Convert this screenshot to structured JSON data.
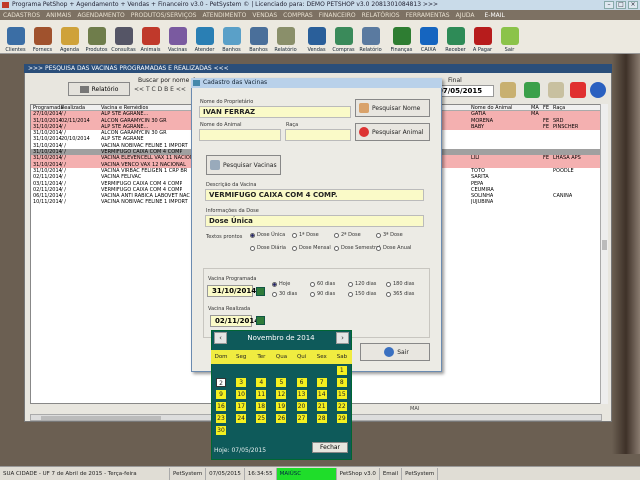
{
  "window": {
    "title": "Programa PetShop + Agendamento + Vendas + Financeiro v3.0 - PetSystem © | Licenciado para: DEMO PETSHOP v3.0 2081301084813 >>>"
  },
  "menu": [
    "CADASTROS",
    "ANIMAIS",
    "AGENDAMENTO",
    "PRODUTOS/SERVIÇOS",
    "ATENDIMENTO",
    "VENDAS",
    "COMPRAS",
    "FINANCEIRO",
    "RELATÓRIOS",
    "FERRAMENTAS",
    "AJUDA"
  ],
  "menu_email": "E-MAIL",
  "toolbar": [
    {
      "label": "Clientes",
      "color": "#3b6ea5"
    },
    {
      "label": "Fornecs",
      "color": "#a0522d"
    },
    {
      "label": "Agenda",
      "color": "#cfa23a"
    },
    {
      "label": "Produtos",
      "color": "#6f7d4b"
    },
    {
      "label": "Consultas",
      "color": "#556"
    },
    {
      "label": "Animais",
      "color": "#c0392b"
    },
    {
      "label": "Vacinas",
      "color": "#7a5aa0"
    },
    {
      "label": "Atender",
      "color": "#2a7fb4"
    },
    {
      "label": "Banhos",
      "color": "#5aa0c8"
    },
    {
      "label": "Banhos",
      "color": "#4a6f9a"
    },
    {
      "label": "Relatório",
      "color": "#8a8f6a"
    },
    {
      "label": "Vendas",
      "color": "#2a5f9a"
    },
    {
      "label": "Compras",
      "color": "#3a8a5a"
    },
    {
      "label": "Relatório",
      "color": "#5a7aa0"
    },
    {
      "label": "Finanças",
      "color": "#2e7d32"
    },
    {
      "label": "CAIXA",
      "color": "#1565c0"
    },
    {
      "label": "Receber",
      "color": "#2e8b57"
    },
    {
      "label": "A Pagar",
      "color": "#b71c1c"
    },
    {
      "label": "Sair",
      "color": "#8bc34a"
    }
  ],
  "panel": {
    "header": ">>>  PESQUISA DAS VACINAS PROGRAMADAS E REALIZADAS  <<<",
    "relatorio_label": "Relatório",
    "busca_label": "Buscar por nome de",
    "alphabet": "<< T C D B E <<",
    "final_label": "Final",
    "final_date": "07/05/2015"
  },
  "table": {
    "columns": [
      "Programada",
      "Realizada",
      "Vacina e Remédios",
      "Nome do Animal",
      "MA",
      "FE",
      "Raça"
    ],
    "rows": [
      {
        "cells": [
          "27/10/2014",
          "/  /",
          "ALP STE AGRANE...",
          "GATIA",
          "MA",
          "",
          ""
        ],
        "bg": "#f4b0b0"
      },
      {
        "cells": [
          "31/10/2014",
          "02/11/2014",
          "ALCON GARAMYCIN 30 GR",
          "MORENA",
          "",
          "FE",
          "SRD"
        ],
        "bg": "#f4b0b0"
      },
      {
        "cells": [
          "31/10/2014",
          "/  /",
          "ALP STE AGRANE...",
          "BABY",
          "",
          "FE",
          "PINSCHER"
        ],
        "bg": "#f4b0b0"
      },
      {
        "cells": [
          "31/10/2014",
          "/  /",
          "ALCON GARAMYCIN 30 GR",
          "",
          "",
          "",
          ""
        ],
        "bg": "#ffffff"
      },
      {
        "cells": [
          "31/10/2014",
          "20/10/2014",
          "ALP STE AGRANE",
          "",
          "",
          "",
          ""
        ],
        "bg": "#ffffff"
      },
      {
        "cells": [
          "31/10/2014",
          "/  /",
          "VACINA NOBIVAC FELINE 1 IMPORT",
          "",
          "",
          "",
          ""
        ],
        "bg": "#ffffff"
      },
      {
        "cells": [
          "31/10/2014",
          "/  /",
          "VERMIFUGO CAIXA COM 4 COMP",
          "",
          "",
          "",
          ""
        ],
        "bg": "#a0a0a0"
      },
      {
        "cells": [
          "31/10/2014",
          "/  /",
          "VACINA ELEVENCELL VAX 11 NACIONAL",
          "LILI",
          "",
          "FE",
          "LHASA APS"
        ],
        "bg": "#f4b0b0"
      },
      {
        "cells": [
          "31/10/2014",
          "/  /",
          "VACINA VENCO VAX 12 NACIONAL",
          "",
          "",
          "",
          ""
        ],
        "bg": "#f4b0b0"
      },
      {
        "cells": [
          "31/10/2014",
          "/  /",
          "VACINA VIRBAC FELIGEN 1 CRP BR",
          "TOTO",
          "",
          "",
          "POODLE"
        ],
        "bg": "#ffffff"
      },
      {
        "cells": [
          "02/11/2014",
          "/  /",
          "VACINA FELIVAC",
          "SARITA",
          "",
          "",
          ""
        ],
        "bg": "#ffffff"
      },
      {
        "cells": [
          "03/11/2014",
          "/  /",
          "VERMIFUGO CAIXA COM 4 COMP",
          "PEPA",
          "",
          "",
          ""
        ],
        "bg": "#ffffff"
      },
      {
        "cells": [
          "02/11/2014",
          "/  /",
          "VERMIFUGO CAIXA COM 4 COMP",
          "CEUMIRA",
          "",
          "",
          ""
        ],
        "bg": "#ffffff"
      },
      {
        "cells": [
          "06/11/2014",
          "/  /",
          "VACINA ANTI RABICA LABOVET NAC",
          "SOLINHA",
          "",
          "",
          "CANINA"
        ],
        "bg": "#ffffff"
      },
      {
        "cells": [
          "10/11/2014",
          "/  /",
          "VACINA NOBIVAC FELINE 1 IMPORT",
          "JUJUBINA",
          "",
          "",
          ""
        ],
        "bg": "#ffffff"
      }
    ],
    "status": "MAI"
  },
  "dialog": {
    "title": "Cadastro das Vacinas",
    "owner_label": "Nome do Proprietário",
    "owner_value": "IVAN FERRAZ",
    "search_owner_btn": "Pesquisar Nome",
    "animal_label": "Nome do Animal",
    "raca_label": "Raça",
    "search_animal_btn": "Pesquisar Animal",
    "search_vaccine_btn": "Pesquisar Vacinas",
    "desc_label": "Descrição da Vacina",
    "desc_value": "VERMIFUGO CAIXA COM 4 COMP.",
    "dose_label": "Informações da Dose",
    "dose_value": "Dose Única",
    "times_label": "Textos prontos",
    "times_row1": [
      {
        "label": "Dose Única",
        "on": true
      },
      {
        "label": "1ª Dose",
        "on": false
      },
      {
        "label": "2ª Dose",
        "on": false
      },
      {
        "label": "3ª Dose",
        "on": false
      }
    ],
    "times_row2": [
      {
        "label": "Dose Diária",
        "on": false
      },
      {
        "label": "Dose Mensal",
        "on": false
      },
      {
        "label": "Dose Semestral",
        "on": false
      },
      {
        "label": "Dose Anual",
        "on": false
      }
    ],
    "programada_label": "Vacina Programada",
    "programada_value": "31/10/2014",
    "period_row1": [
      {
        "label": "Hoje",
        "on": true
      },
      {
        "label": "60 dias",
        "on": false
      },
      {
        "label": "120 dias",
        "on": false
      },
      {
        "label": "180 dias",
        "on": false
      }
    ],
    "period_row2": [
      {
        "label": "30 dias",
        "on": false
      },
      {
        "label": "90 dias",
        "on": false
      },
      {
        "label": "150 dias",
        "on": false
      },
      {
        "label": "365 dias",
        "on": false
      }
    ],
    "realizada_label": "Vacina Realizada",
    "realizada_value": "02/11/2014",
    "sair_label": "Sair"
  },
  "calendar": {
    "month_title": "Novembro de 2014",
    "days": [
      "Dom",
      "Seg",
      "Ter",
      "Qua",
      "Qui",
      "Sex",
      "Sab"
    ],
    "today": "Hoje: 07/05/2015",
    "close_label": "Fechar",
    "dates": [
      "1",
      "2",
      "3",
      "4",
      "5",
      "6",
      "7",
      "8",
      "9",
      "10",
      "11",
      "12",
      "13",
      "14",
      "15",
      "16",
      "17",
      "18",
      "19",
      "20",
      "21",
      "22",
      "23",
      "24",
      "25",
      "26",
      "27",
      "28",
      "29",
      "30"
    ],
    "first_weekday": 6,
    "selected": "2"
  },
  "statusbar": [
    {
      "text": "SUA CIDADE - UF 7 de Abril de 2015 - Terça-feira"
    },
    {
      "text": "PetSystem"
    },
    {
      "text": "07/05/2015"
    },
    {
      "text": "16:34:55"
    },
    {
      "text": "MAIÚSC",
      "green": true
    },
    {
      "text": "PetShop v3.0"
    },
    {
      "text": "Email"
    },
    {
      "text": "PetSystem"
    }
  ]
}
